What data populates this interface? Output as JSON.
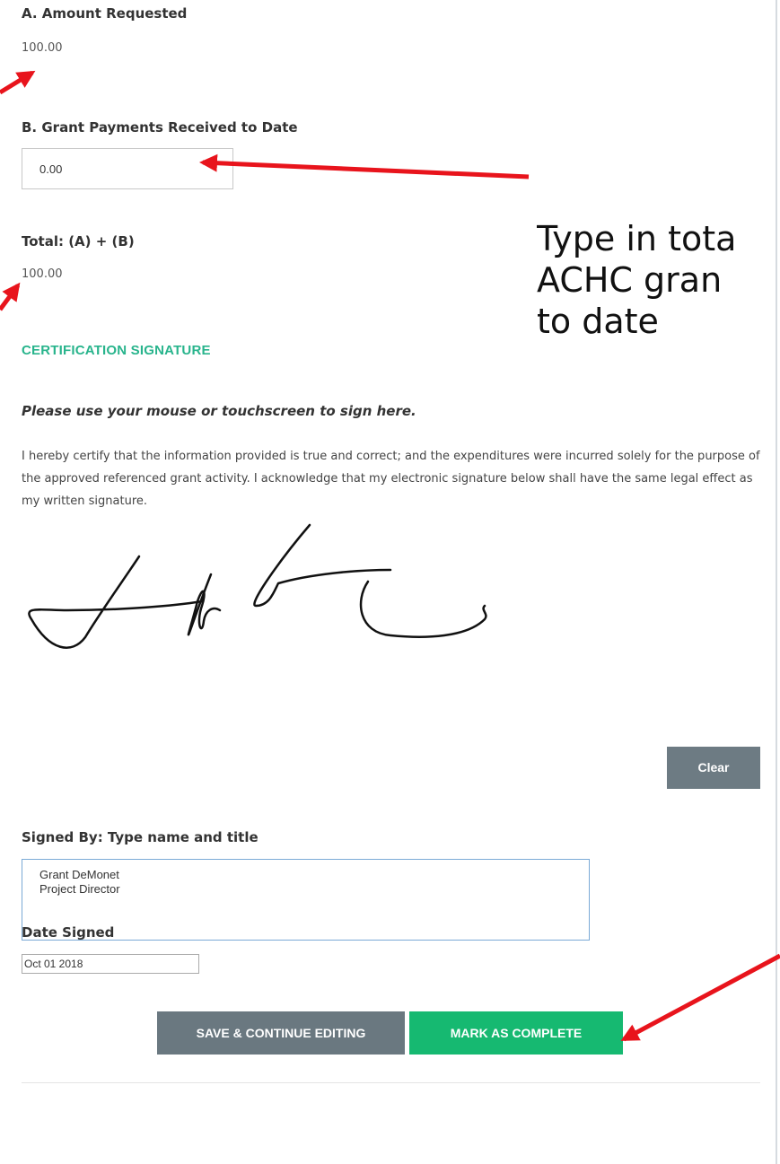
{
  "amount_requested": {
    "label": "A. Amount Requested",
    "value": "100.00"
  },
  "grant_payments": {
    "label": "B. Grant Payments Received to Date",
    "value": "0.00"
  },
  "total": {
    "label": "Total: (A) + (B)",
    "value": "100.00"
  },
  "certification": {
    "heading": "CERTIFICATION SIGNATURE",
    "instruction": "Please use your mouse or touchscreen to sign here.",
    "text": "I hereby certify that the information provided is true and correct; and the expenditures were incurred solely for the purpose of the approved referenced grant activity. I acknowledge that my electronic signature below shall have the same legal effect as my written signature.",
    "clear_label": "Clear"
  },
  "signed_by": {
    "label": "Signed By: Type name and title",
    "value": "Grant DeMonet\nProject Director"
  },
  "date_signed": {
    "label": "Date Signed",
    "value": "Oct 01 2018"
  },
  "actions": {
    "save_label": "SAVE & CONTINUE EDITING",
    "complete_label": "MARK AS COMPLETE"
  },
  "annotation": {
    "line1": "Type in tota",
    "line2": "ACHC gran",
    "line3": "to date"
  },
  "colors": {
    "accent": "#28b48c",
    "complete": "#16b971",
    "secondary_button": "#6a7880",
    "arrow": "#e8141c"
  }
}
